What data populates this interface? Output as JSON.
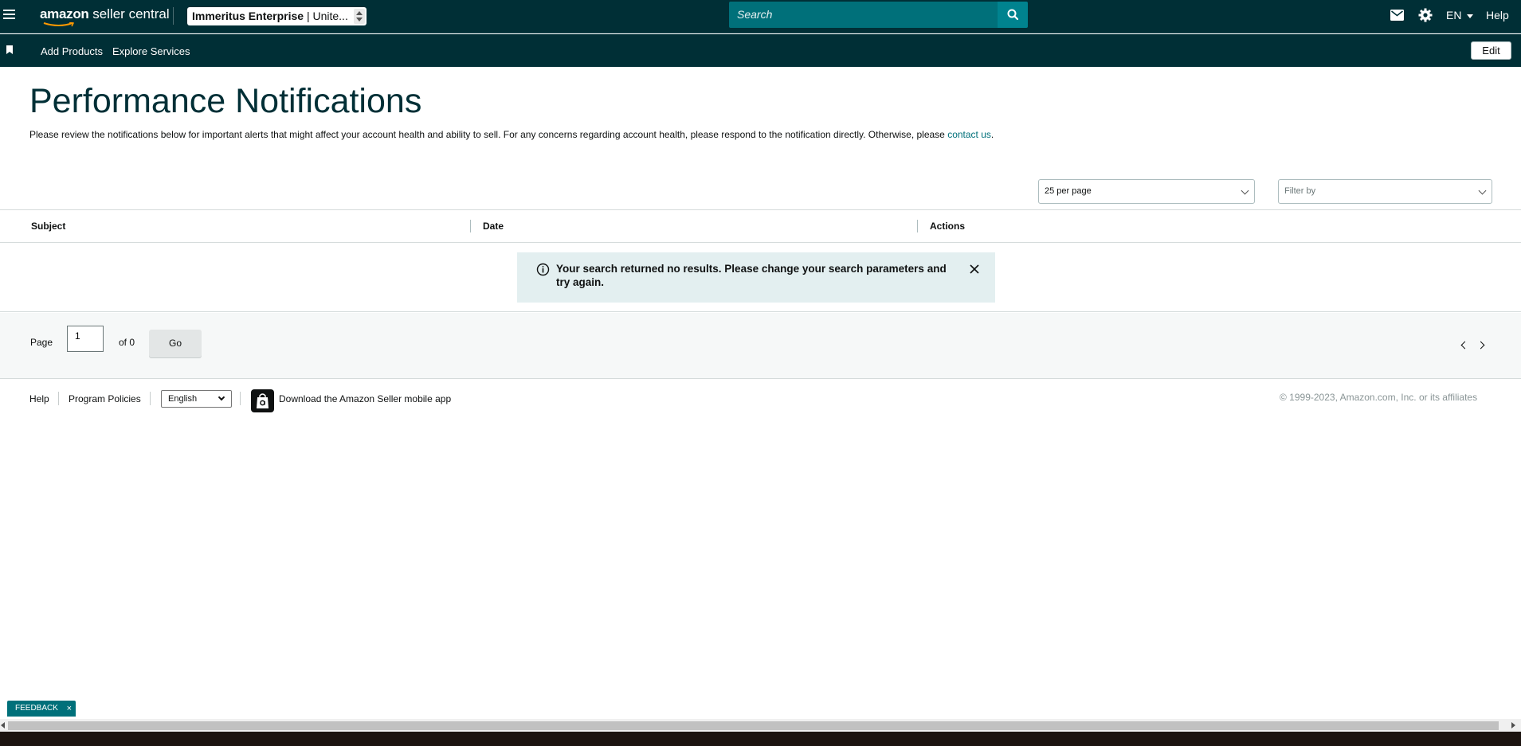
{
  "topbar": {
    "logo_brand": "amazon",
    "logo_suffix": " seller central",
    "account_name": "Immeritus Enterprise",
    "account_region": " | Unite...",
    "search_placeholder": "Search",
    "language": "EN",
    "help": "Help"
  },
  "subbar": {
    "add_products": "Add Products",
    "explore_services": "Explore Services",
    "edit": "Edit"
  },
  "main": {
    "title": "Performance Notifications",
    "intro": "Please review the notifications below for important alerts that might affect your account health and ability to sell. For any concerns regarding account health, please respond to the notification directly. Otherwise, please ",
    "contact_link": "contact us",
    "intro_end": ".",
    "per_page": "25 per page",
    "filter_placeholder": "Filter by"
  },
  "table": {
    "columns": [
      "Subject",
      "Date",
      "Actions"
    ],
    "empty_message": "Your search returned no results. Please change your search parameters and try again."
  },
  "pagination": {
    "page_label": "Page",
    "current_page": "1",
    "of_label": "of 0",
    "go": "Go"
  },
  "footer": {
    "help": "Help",
    "program_policies": "Program Policies",
    "language": "English",
    "app_download": "Download the Amazon Seller mobile app",
    "copyright": "© 1999-2023, Amazon.com, Inc. or its affiliates"
  },
  "feedback": {
    "label": "FEEDBACK",
    "close": "×"
  },
  "colors": {
    "nav_bg": "#002f36",
    "search_bg": "#00707a",
    "accent": "#00838f",
    "alert_bg": "#e3eff0",
    "link": "#00707a"
  }
}
